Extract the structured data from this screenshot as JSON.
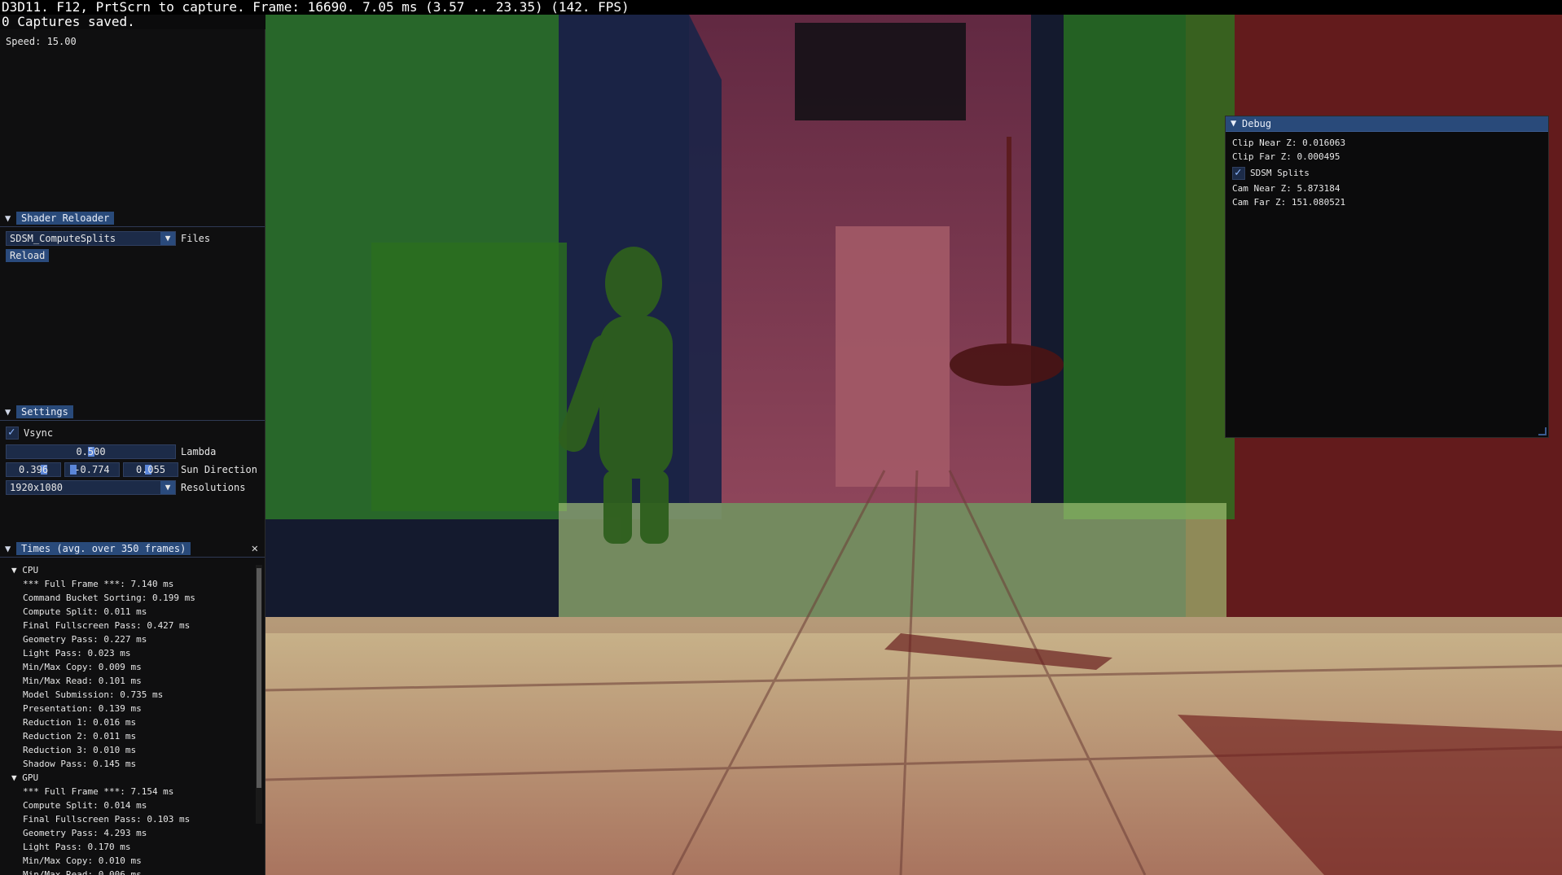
{
  "top_overlay": {
    "line1": "D3D11. F12, PrtScrn to capture. Frame: 16690. 7.05 ms (3.57 .. 23.35) (142. FPS)",
    "line2": "0 Captures saved."
  },
  "speed_panel": {
    "speed_text": "Speed: 15.00"
  },
  "shader_reloader": {
    "title": "Shader Reloader",
    "selected_shader": "SDSM_ComputeSplits",
    "files_label": "Files",
    "reload_button": "Reload"
  },
  "settings": {
    "title": "Settings",
    "vsync_label": "Vsync",
    "vsync_checked": true,
    "lambda_value": "0.500",
    "lambda_fraction": 0.5,
    "lambda_label": "Lambda",
    "sun_direction": {
      "x": "0.396",
      "y": "-0.774",
      "z": "0.055",
      "label": "Sun Direction"
    },
    "resolution_value": "1920x1080",
    "resolution_label": "Resolutions"
  },
  "times": {
    "title": "Times (avg. over 350 frames)",
    "cpu_header": "CPU",
    "cpu_items": [
      "*** Full Frame ***: 7.140 ms",
      "Command Bucket Sorting: 0.199 ms",
      "Compute Split: 0.011 ms",
      "Final Fullscreen Pass: 0.427 ms",
      "Geometry Pass: 0.227 ms",
      "Light Pass: 0.023 ms",
      "Min/Max Copy: 0.009 ms",
      "Min/Max Read: 0.101 ms",
      "Model Submission: 0.735 ms",
      "Presentation: 0.139 ms",
      "Reduction 1: 0.016 ms",
      "Reduction 2: 0.011 ms",
      "Reduction 3: 0.010 ms",
      "Shadow Pass: 0.145 ms"
    ],
    "gpu_header": "GPU",
    "gpu_items": [
      "*** Full Frame ***: 7.154 ms",
      "Compute Split: 0.014 ms",
      "Final Fullscreen Pass: 0.103 ms",
      "Geometry Pass: 4.293 ms",
      "Light Pass: 0.170 ms",
      "Min/Max Copy: 0.010 ms",
      "Min/Max Read: 0.006 ms"
    ]
  },
  "debug": {
    "title": "Debug",
    "clip_near": "Clip Near Z: 0.016063",
    "clip_far": "Clip Far Z: 0.000495",
    "sdsm_splits_label": "SDSM Splits",
    "sdsm_splits_checked": true,
    "cam_near": "Cam Near Z: 5.873184",
    "cam_far": "Cam Far Z: 151.080521"
  }
}
